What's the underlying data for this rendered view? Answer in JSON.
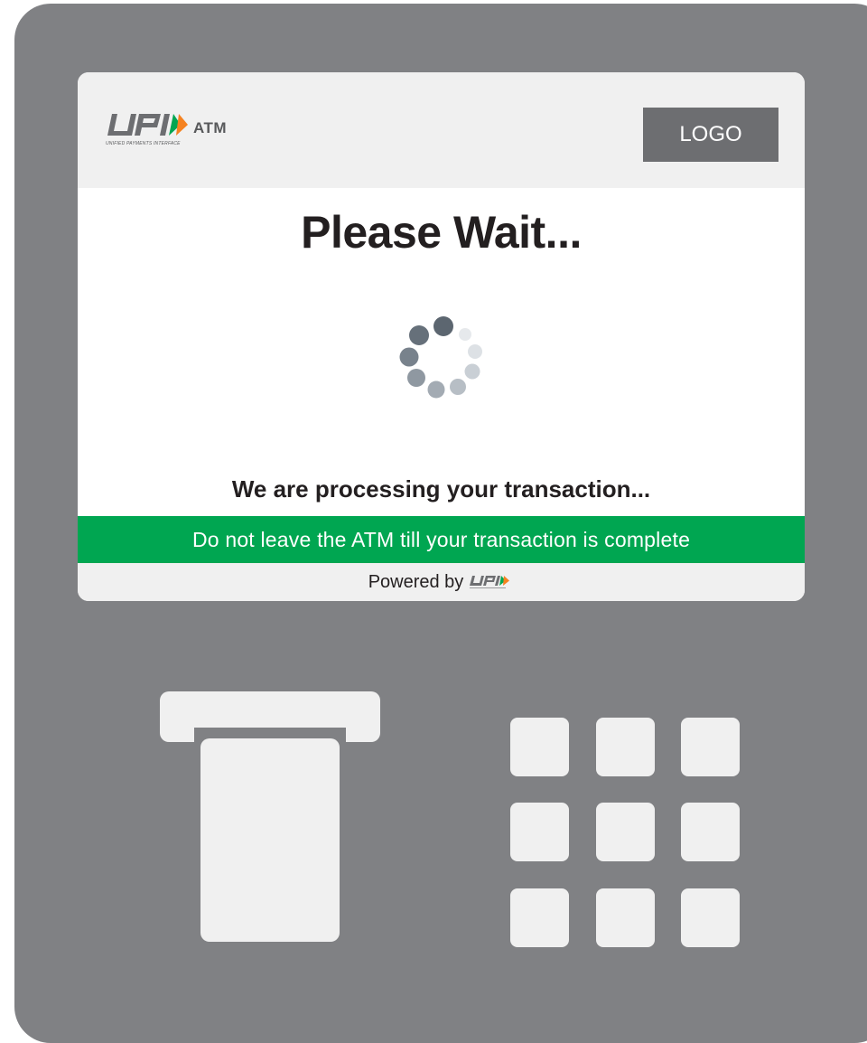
{
  "header": {
    "upi_brand": "UPI",
    "upi_product": "ATM",
    "upi_tagline": "UNIFIED PAYMENTS INTERFACE",
    "bank_logo_label": "LOGO"
  },
  "main": {
    "title": "Please Wait...",
    "processing_message": "We are processing your transaction...",
    "warning_message": "Do not leave the ATM till your transaction is complete"
  },
  "footer": {
    "powered_by_label": "Powered by",
    "powered_by_brand": "UPI"
  },
  "keypad": {
    "rows": 3,
    "cols": 3
  },
  "colors": {
    "atm_body": "#808184",
    "screen_panel": "#f0f0f0",
    "warning_green": "#00a651",
    "upi_orange": "#f58220",
    "upi_green": "#00a651",
    "text_dark": "#231f20"
  },
  "icons": {
    "spinner": "loading-spinner-icon",
    "upi_logo": "upi-logo-icon"
  }
}
